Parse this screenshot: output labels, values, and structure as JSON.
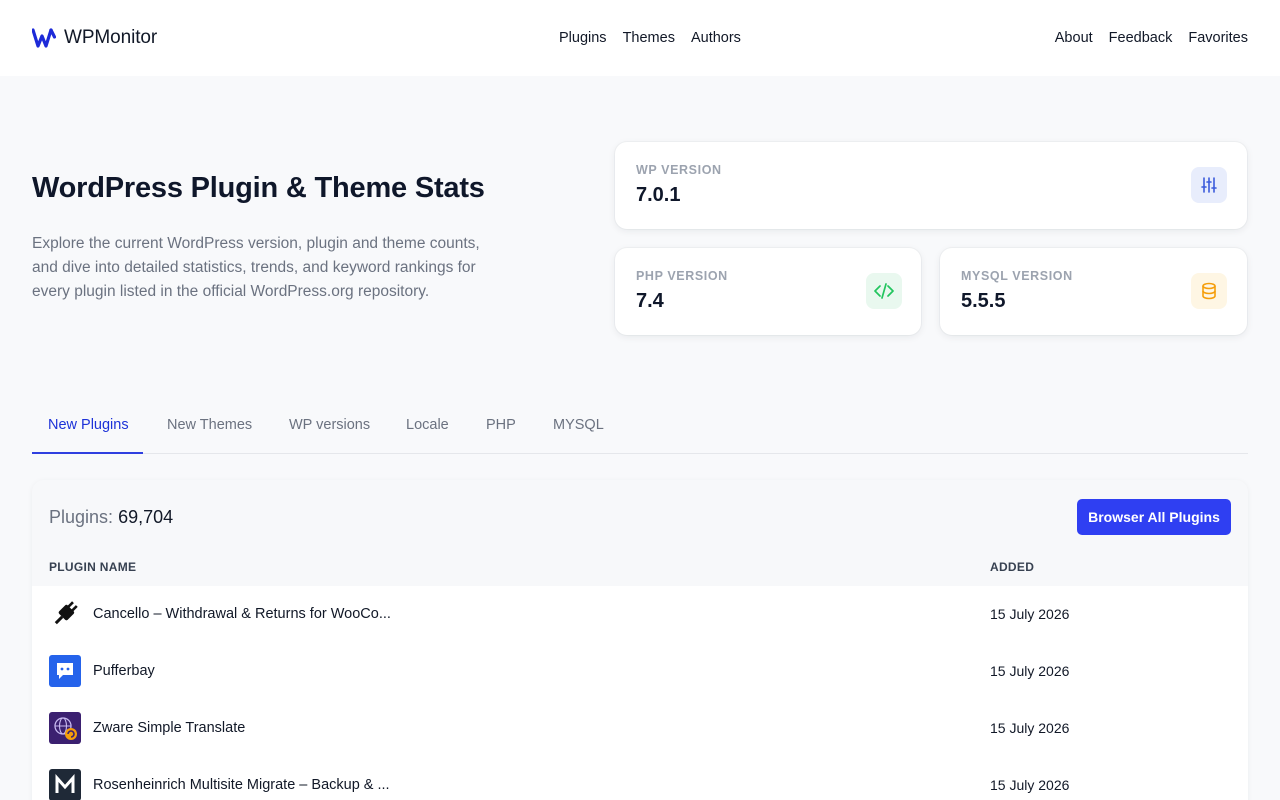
{
  "header": {
    "brand": "WPMonitor",
    "nav_center": [
      "Plugins",
      "Themes",
      "Authors"
    ],
    "nav_right": [
      "About",
      "Feedback",
      "Favorites"
    ]
  },
  "hero": {
    "title": "WordPress Plugin & Theme Stats",
    "description": "Explore the current WordPress version, plugin and theme counts, and dive into detailed statistics, trends, and keyword rankings for every plugin listed in the official WordPress.org repository."
  },
  "stats": {
    "wp": {
      "label": "WP VERSION",
      "value": "7.0.1",
      "icon": "sliders-icon",
      "color": "#3b5bdb"
    },
    "php": {
      "label": "PHP VERSION",
      "value": "7.4",
      "icon": "code-icon",
      "color": "#22c55e"
    },
    "mysql": {
      "label": "MYSQL VERSION",
      "value": "5.5.5",
      "icon": "database-icon",
      "color": "#f59e0b"
    }
  },
  "tabs": [
    "New Plugins",
    "New Themes",
    "WP versions",
    "Locale",
    "PHP",
    "MYSQL"
  ],
  "active_tab": "New Plugins",
  "plugins_panel": {
    "count_label": "Plugins:",
    "count_value": "69,704",
    "browse_button": "Browser All Plugins",
    "columns": {
      "name": "PLUGIN NAME",
      "added": "ADDED"
    },
    "rows": [
      {
        "name": "Cancello – Withdrawal & Returns for WooCo...",
        "added": "15 July 2026",
        "icon": "plug-icon"
      },
      {
        "name": "Pufferbay",
        "added": "15 July 2026",
        "icon": "chat-bubble-icon"
      },
      {
        "name": "Zware Simple Translate",
        "added": "15 July 2026",
        "icon": "globe-translate-icon"
      },
      {
        "name": "Rosenheinrich Multisite Migrate – Backup & ...",
        "added": "15 July 2026",
        "icon": "letter-m-icon"
      }
    ]
  },
  "colors": {
    "accent": "#2f3ff2",
    "active_tab": "#1d32d8"
  }
}
